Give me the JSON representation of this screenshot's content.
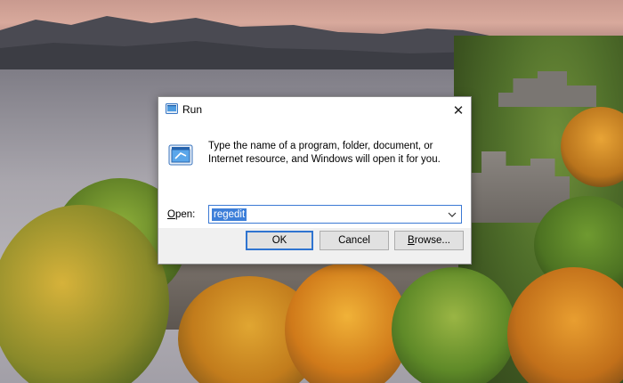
{
  "dialog": {
    "title": "Run",
    "description": "Type the name of a program, folder, document, or Internet resource, and Windows will open it for you.",
    "open_label_prefix": "",
    "open_label_underlined": "O",
    "open_label_rest": "pen:",
    "open_value": "regedit",
    "close_glyph": "✕",
    "dropdown_glyph": "⌄",
    "buttons": {
      "ok": "OK",
      "cancel": "Cancel",
      "browse_underlined": "B",
      "browse_rest": "rowse..."
    }
  },
  "icons": {
    "title_icon": "run-icon",
    "dialog_icon": "run-large-icon"
  },
  "colors": {
    "accent": "#2f74d0",
    "selection": "#3d7fd9",
    "dialog_bg": "#f0f0f0"
  }
}
